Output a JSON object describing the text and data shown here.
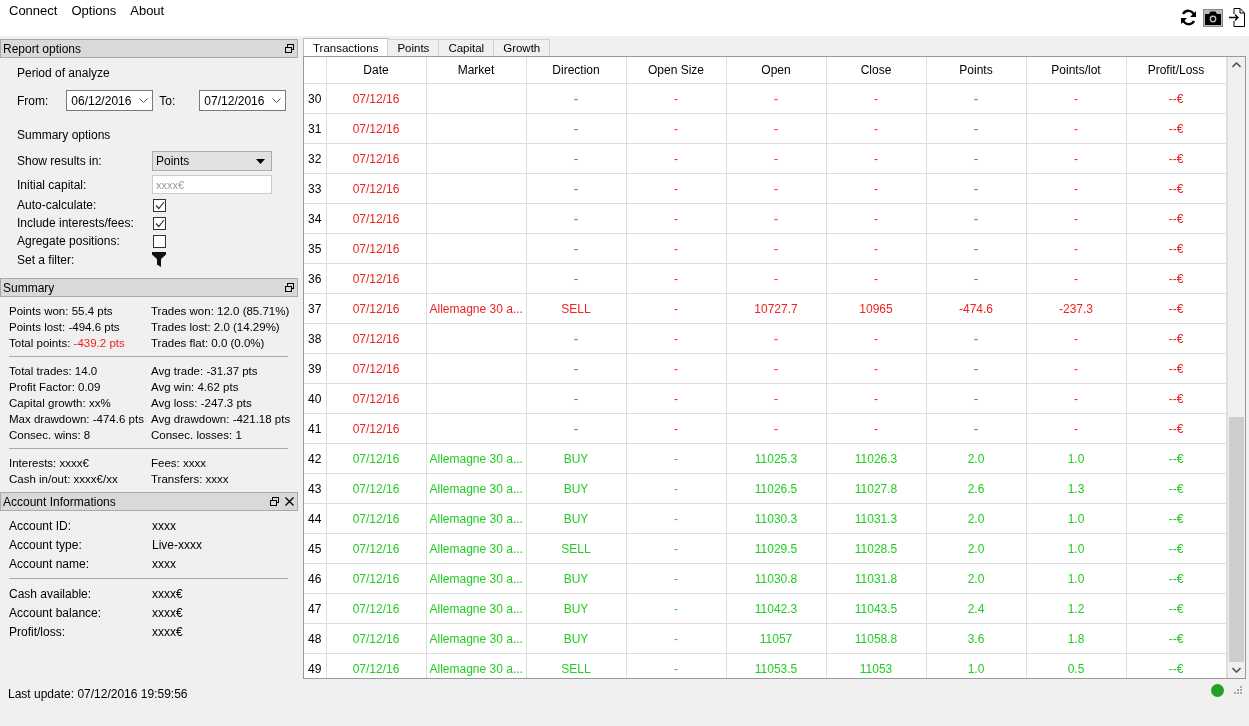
{
  "menu": [
    "Connect",
    "Options",
    "About"
  ],
  "report_options": {
    "title": "Report options",
    "period_heading": "Period of analyze",
    "from_label": "From:",
    "from_value": "06/12/2016",
    "to_label": "To:",
    "to_value": "07/12/2016",
    "summary_heading": "Summary options",
    "settings": [
      {
        "kind": "select",
        "label": "Show results in:",
        "value": "Points"
      },
      {
        "kind": "input",
        "label": "Initial capital:",
        "placeholder": "xxxx€"
      },
      {
        "kind": "checkbox",
        "label": "Auto-calculate:",
        "checked": true
      },
      {
        "kind": "checkbox",
        "label": "Include interests/fees:",
        "checked": true
      },
      {
        "kind": "checkbox",
        "label": "Agregate positions:",
        "checked": false
      },
      {
        "kind": "filter",
        "label": "Set a filter:"
      }
    ]
  },
  "summary": {
    "title": "Summary",
    "groups": [
      [
        {
          "label": "Points won:",
          "value": "55.4 pts",
          "negative": false
        },
        {
          "label": "Trades won:",
          "value": "12.0 (85.71%)",
          "negative": false
        },
        {
          "label": "Points lost:",
          "value": "-494.6 pts",
          "negative": false
        },
        {
          "label": "Trades lost:",
          "value": "2.0 (14.29%)",
          "negative": false
        },
        {
          "label": "Total points:",
          "value": "-439.2 pts",
          "negative": true
        },
        {
          "label": "Trades flat:",
          "value": "0.0 (0.0%)",
          "negative": false
        }
      ],
      [
        {
          "label": "Total trades:",
          "value": "14.0",
          "negative": false
        },
        {
          "label": "Avg trade:",
          "value": "-31.37 pts",
          "negative": false
        },
        {
          "label": "Profit Factor:",
          "value": "0.09",
          "negative": false
        },
        {
          "label": "Avg win:",
          "value": "4.62 pts",
          "negative": false
        },
        {
          "label": "Capital growth:",
          "value": "xx%",
          "negative": false
        },
        {
          "label": "Avg loss:",
          "value": "-247.3 pts",
          "negative": false
        },
        {
          "label": "Max drawdown:",
          "value": "-474.6 pts",
          "negative": false
        },
        {
          "label": "Avg drawdown:",
          "value": "-421.18 pts",
          "negative": false
        },
        {
          "label": "Consec. wins:",
          "value": "8",
          "negative": false
        },
        {
          "label": "Consec. losses:",
          "value": "1",
          "negative": false
        }
      ],
      [
        {
          "label": "Interests:",
          "value": "xxxx€",
          "negative": false
        },
        {
          "label": "Fees:",
          "value": "xxxx",
          "negative": false
        },
        {
          "label": "Cash in/out:",
          "value": "xxxx€/xx",
          "negative": false
        },
        {
          "label": "Transfers:",
          "value": "xxxx",
          "negative": false
        }
      ]
    ]
  },
  "account": {
    "title": "Account Informations",
    "groups": [
      [
        {
          "label": "Account ID:",
          "value": "xxxx"
        },
        {
          "label": "Account type:",
          "value": "Live-xxxx"
        },
        {
          "label": "Account name:",
          "value": "xxxx"
        }
      ],
      [
        {
          "label": "Cash available:",
          "value": "xxxx€"
        },
        {
          "label": "Account balance:",
          "value": "xxxx€"
        },
        {
          "label": "Profit/loss:",
          "value": "xxxx€"
        }
      ]
    ]
  },
  "status_bar": {
    "text": "Last update: 07/12/2016 19:59:56",
    "connected": true
  },
  "tabs": [
    {
      "label": "Transactions",
      "selected": true
    },
    {
      "label": "Points",
      "selected": false
    },
    {
      "label": "Capital",
      "selected": false
    },
    {
      "label": "Growth",
      "selected": false
    }
  ],
  "table": {
    "columns": [
      "Date",
      "Market",
      "Direction",
      "Open Size",
      "Open",
      "Close",
      "Points",
      "Points/lot",
      "Profit/Loss"
    ],
    "rows": [
      {
        "n": "30",
        "color": "#ee2222",
        "cells": [
          "07/12/16",
          null,
          "-",
          "-",
          "-",
          "-",
          "-",
          "-",
          "--€"
        ]
      },
      {
        "n": "31",
        "color": "#ee2222",
        "cells": [
          "07/12/16",
          null,
          "-",
          "-",
          "-",
          "-",
          "-",
          "-",
          "--€"
        ]
      },
      {
        "n": "32",
        "color": "#ee2222",
        "cells": [
          "07/12/16",
          null,
          "-",
          "-",
          "-",
          "-",
          "-",
          "-",
          "--€"
        ]
      },
      {
        "n": "33",
        "color": "#ee2222",
        "cells": [
          "07/12/16",
          null,
          "-",
          "-",
          "-",
          "-",
          "-",
          "-",
          "--€"
        ]
      },
      {
        "n": "34",
        "color": "#ee2222",
        "cells": [
          "07/12/16",
          null,
          "-",
          "-",
          "-",
          "-",
          "-",
          "-",
          "--€"
        ]
      },
      {
        "n": "35",
        "color": "#ee2222",
        "cells": [
          "07/12/16",
          null,
          "-",
          "-",
          "-",
          "-",
          "-",
          "-",
          "--€"
        ]
      },
      {
        "n": "36",
        "color": "#ee2222",
        "cells": [
          "07/12/16",
          null,
          "-",
          "-",
          "-",
          "-",
          "-",
          "-",
          "--€"
        ]
      },
      {
        "n": "37",
        "color": "#ee2222",
        "cells": [
          "07/12/16",
          "Allemagne 30 a...",
          "SELL",
          "-",
          "10727.7",
          "10965",
          "-474.6",
          "-237.3",
          "--€"
        ]
      },
      {
        "n": "38",
        "color": "#ee2222",
        "cells": [
          "07/12/16",
          null,
          "-",
          "-",
          "-",
          "-",
          "-",
          "-",
          "--€"
        ]
      },
      {
        "n": "39",
        "color": "#ee2222",
        "cells": [
          "07/12/16",
          null,
          "-",
          "-",
          "-",
          "-",
          "-",
          "-",
          "--€"
        ]
      },
      {
        "n": "40",
        "color": "#ee2222",
        "cells": [
          "07/12/16",
          null,
          "-",
          "-",
          "-",
          "-",
          "-",
          "-",
          "--€"
        ]
      },
      {
        "n": "41",
        "color": "#ee2222",
        "cells": [
          "07/12/16",
          null,
          "-",
          "-",
          "-",
          "-",
          "-",
          "-",
          "--€"
        ]
      },
      {
        "n": "42",
        "color": "#22cc22",
        "cells": [
          "07/12/16",
          "Allemagne 30 a...",
          "BUY",
          "-",
          "11025.3",
          "11026.3",
          "2.0",
          "1.0",
          "--€"
        ]
      },
      {
        "n": "43",
        "color": "#22cc22",
        "cells": [
          "07/12/16",
          "Allemagne 30 a...",
          "BUY",
          "-",
          "11026.5",
          "11027.8",
          "2.6",
          "1.3",
          "--€"
        ]
      },
      {
        "n": "44",
        "color": "#22cc22",
        "cells": [
          "07/12/16",
          "Allemagne 30 a...",
          "BUY",
          "-",
          "11030.3",
          "11031.3",
          "2.0",
          "1.0",
          "--€"
        ]
      },
      {
        "n": "45",
        "color": "#22cc22",
        "cells": [
          "07/12/16",
          "Allemagne 30 a...",
          "SELL",
          "-",
          "11029.5",
          "11028.5",
          "2.0",
          "1.0",
          "--€"
        ]
      },
      {
        "n": "46",
        "color": "#22cc22",
        "cells": [
          "07/12/16",
          "Allemagne 30 a...",
          "BUY",
          "-",
          "11030.8",
          "11031.8",
          "2.0",
          "1.0",
          "--€"
        ]
      },
      {
        "n": "47",
        "color": "#22cc22",
        "cells": [
          "07/12/16",
          "Allemagne 30 a...",
          "BUY",
          "-",
          "11042.3",
          "11043.5",
          "2.4",
          "1.2",
          "--€"
        ]
      },
      {
        "n": "48",
        "color": "#22cc22",
        "cells": [
          "07/12/16",
          "Allemagne 30 a...",
          "BUY",
          "-",
          "11057",
          "11058.8",
          "3.6",
          "1.8",
          "--€"
        ]
      },
      {
        "n": "49",
        "color": "#22cc22",
        "cells": [
          "07/12/16",
          "Allemagne 30 a...",
          "SELL",
          "-",
          "11053.5",
          "11053",
          "1.0",
          "0.5",
          "--€"
        ]
      }
    ]
  }
}
